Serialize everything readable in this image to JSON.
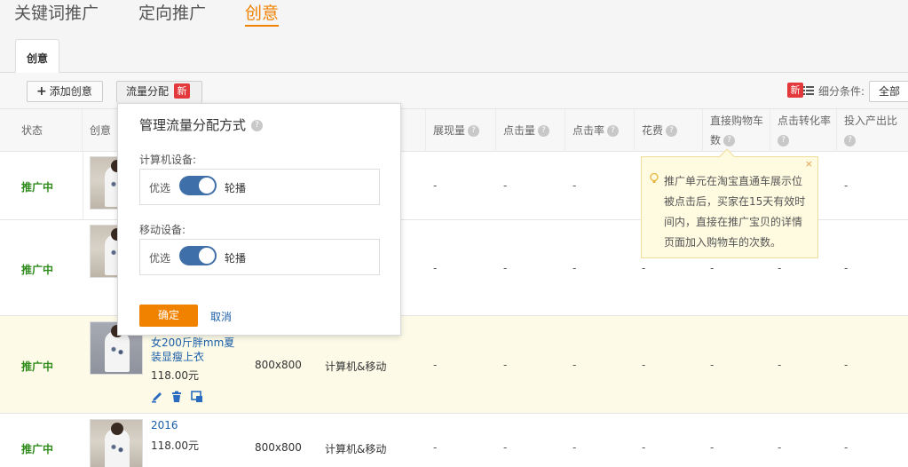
{
  "top_tabs": [
    "关键词推广",
    "定向推广",
    "创意"
  ],
  "sub_tab": "创意",
  "toolbar": {
    "add_label": "添加创意",
    "flow_label": "流量分配",
    "new_badge": "新",
    "filter_label": "细分条件:",
    "filter_value": "全部"
  },
  "table": {
    "headers": {
      "status": "状态",
      "creative": "创意",
      "impressions": "展现量",
      "clicks": "点击量",
      "ctr": "点击率",
      "cost": "花费",
      "cart_l1": "直接购物车",
      "cart_l2": "数",
      "conv": "点击转化率",
      "roi": "投入产出比"
    },
    "rows": [
      {
        "status": "推广中",
        "dash": "-"
      },
      {
        "status": "推广中",
        "dash": "-"
      },
      {
        "status": "推广中",
        "title": "女200斤胖mm夏装显瘦上衣",
        "price": "118.00元",
        "size": "800x800",
        "device": "计算机&移动",
        "dash": "-"
      },
      {
        "status": "推广中",
        "title": "2016",
        "price": "118.00元",
        "size": "800x800",
        "device": "计算机&移动",
        "dash": "-"
      }
    ]
  },
  "popover": {
    "title": "管理流量分配方式",
    "pc_label": "计算机设备:",
    "mobile_label": "移动设备:",
    "opt_prefer": "优选",
    "opt_rotate": "轮播",
    "ok": "确定",
    "cancel": "取消"
  },
  "tooltip": {
    "text": "推广单元在淘宝直通车展示位被点击后，买家在15天有效时间内，直接在推广宝贝的详情页面加入购物车的次数。",
    "close": "×"
  },
  "colors": {
    "accent": "#f08200",
    "link": "#1a5ea8",
    "status": "#2e8b1c",
    "badge": "#e4393c"
  }
}
